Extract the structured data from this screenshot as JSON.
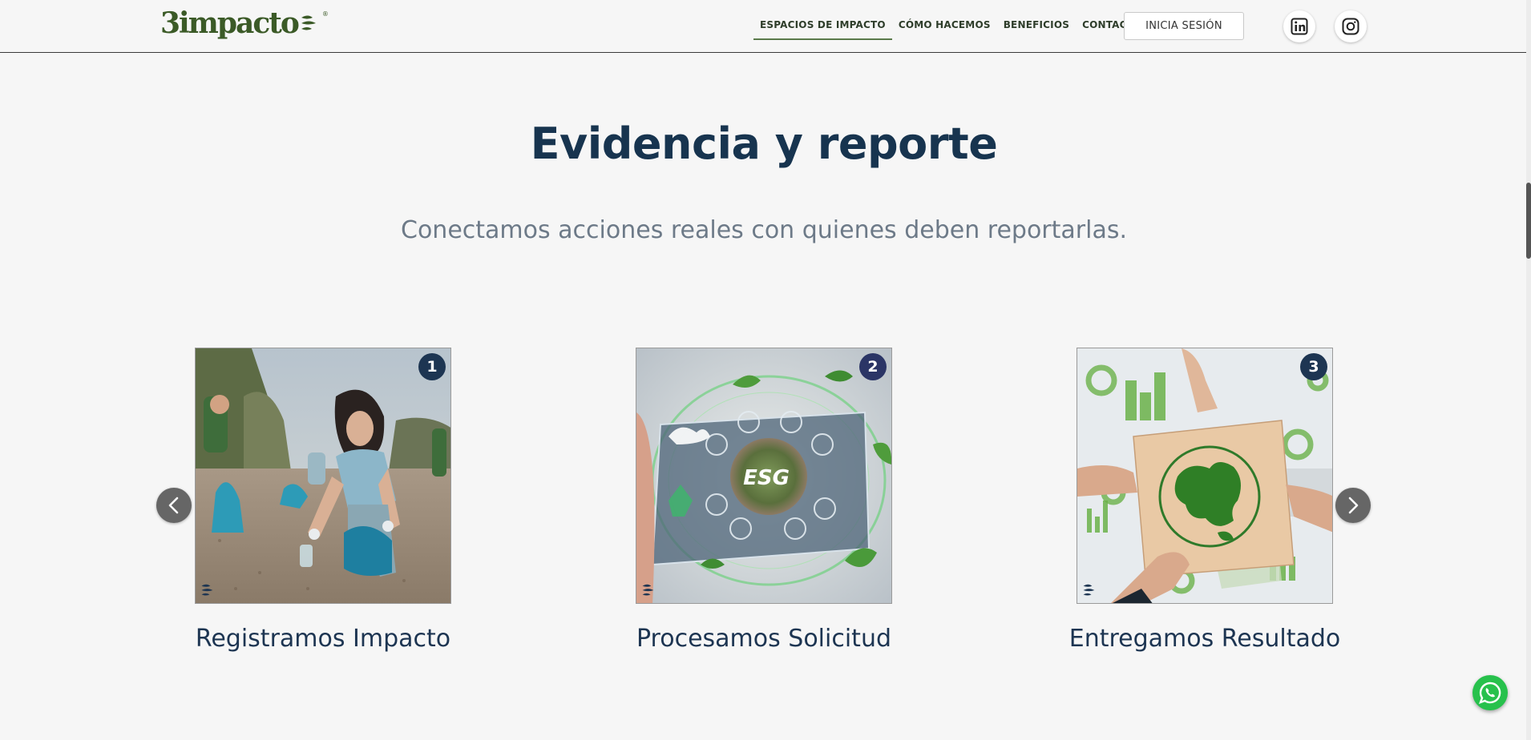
{
  "header": {
    "logo_text": "3impacto",
    "logo_reg": "®",
    "nav": [
      {
        "label": "ESPACIOS DE IMPACTO",
        "active": true
      },
      {
        "label": "CÓMO HACEMOS",
        "active": false
      },
      {
        "label": "BENEFICIOS",
        "active": false
      },
      {
        "label": "CONTACTO",
        "active": false
      }
    ],
    "login_label": "INICIA SESIÓN",
    "social_icons": [
      "linkedin-icon",
      "instagram-icon"
    ]
  },
  "section": {
    "title": "Evidencia y reporte",
    "subtitle": "Conectamos acciones reales con quienes deben reportarlas."
  },
  "cards": [
    {
      "number": "1",
      "title": "Registramos Impacto",
      "image": "volunteers-cleaning-beach"
    },
    {
      "number": "2",
      "title": "Procesamos Solicitud",
      "image": "esg-tablet-hologram",
      "image_text": "ESG"
    },
    {
      "number": "3",
      "title": "Entregamos Resultado",
      "image": "hands-holding-globe-puzzle"
    }
  ],
  "carousel": {
    "prev_icon": "chevron-left-icon",
    "next_icon": "chevron-right-icon"
  },
  "floating": {
    "whatsapp_icon": "whatsapp-icon"
  },
  "colors": {
    "brand_green": "#3b5a27",
    "title_navy": "#17344f",
    "subtitle_gray": "#6d7a88",
    "badge_navy": "#1d3552",
    "background": "#f6f6f6",
    "whatsapp_green": "#27c14c"
  }
}
